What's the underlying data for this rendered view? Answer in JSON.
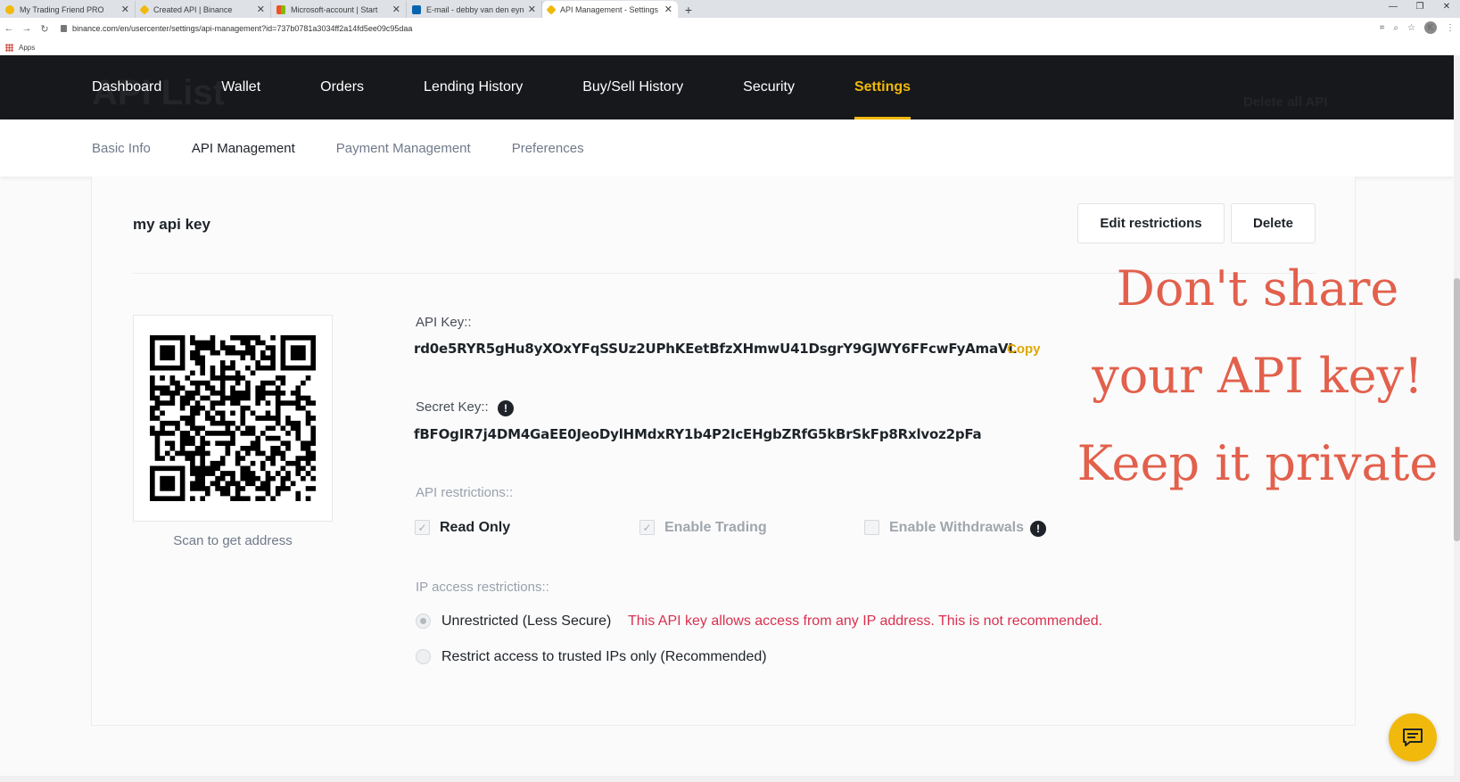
{
  "browser": {
    "tabs": [
      {
        "title": "My Trading Friend PRO",
        "fav": "#f0b90b"
      },
      {
        "title": "Created API | Binance",
        "fav": "#f0b90b"
      },
      {
        "title": "Microsoft-account | Start",
        "fav": "#f25022"
      },
      {
        "title": "E-mail - debby van den eynde - ",
        "fav": "#0a64ad"
      },
      {
        "title": "API Management - Settings - Bi",
        "fav": "#f0b90b"
      }
    ],
    "url": "binance.com/en/usercenter/settings/api-management?id=737b0781a3034ff2a14fd5ee09c95daa",
    "bookmarks_label": "Apps",
    "profile_initial": "K"
  },
  "nav": {
    "items": [
      "Dashboard",
      "Wallet",
      "Orders",
      "Lending History",
      "Buy/Sell History",
      "Security",
      "Settings"
    ],
    "active": "Settings",
    "ghost_title": "API List",
    "ghost_delete": "Delete all API"
  },
  "subnav": {
    "items": [
      "Basic Info",
      "API Management",
      "Payment Management",
      "Preferences"
    ],
    "active": "API Management"
  },
  "api": {
    "name": "my api key",
    "edit_label": "Edit restrictions",
    "delete_label": "Delete",
    "qr_caption": "Scan to get address",
    "api_key_label": "API Key::",
    "api_key": "rd0e5RYR5gHu8yXOxYFqSSUz2UPhKEetBfzXHmwU41DsgrY9GJWY6FFcwFyAmaVL",
    "copy_label": "Copy",
    "secret_key_label": "Secret Key::",
    "secret_key": "fBFOgIR7j4DM4GaEE0JeoDylHMdxRY1b4P2IcEHgbZRfG5kBrSkFp8Rxlvoz2pFa",
    "restrictions_label": "API restrictions::",
    "restrictions": [
      {
        "label": "Read Only",
        "checked": true
      },
      {
        "label": "Enable Trading",
        "checked": true
      },
      {
        "label": "Enable Withdrawals",
        "checked": false
      }
    ],
    "ip_label": "IP access restrictions::",
    "ip_options": [
      {
        "label": "Unrestricted (Less Secure)",
        "selected": true
      },
      {
        "label": "Restrict access to trusted IPs only (Recommended)",
        "selected": false
      }
    ],
    "ip_warning": "This API key allows access from any IP address. This is not recommended."
  },
  "overlay": {
    "line1": "Don't share",
    "line2": "your API key!",
    "line3": "Keep it private"
  },
  "colors": {
    "accent": "#f0b90b",
    "warning": "#d9304f",
    "overlay": "#e2604c",
    "header": "#16181b"
  }
}
